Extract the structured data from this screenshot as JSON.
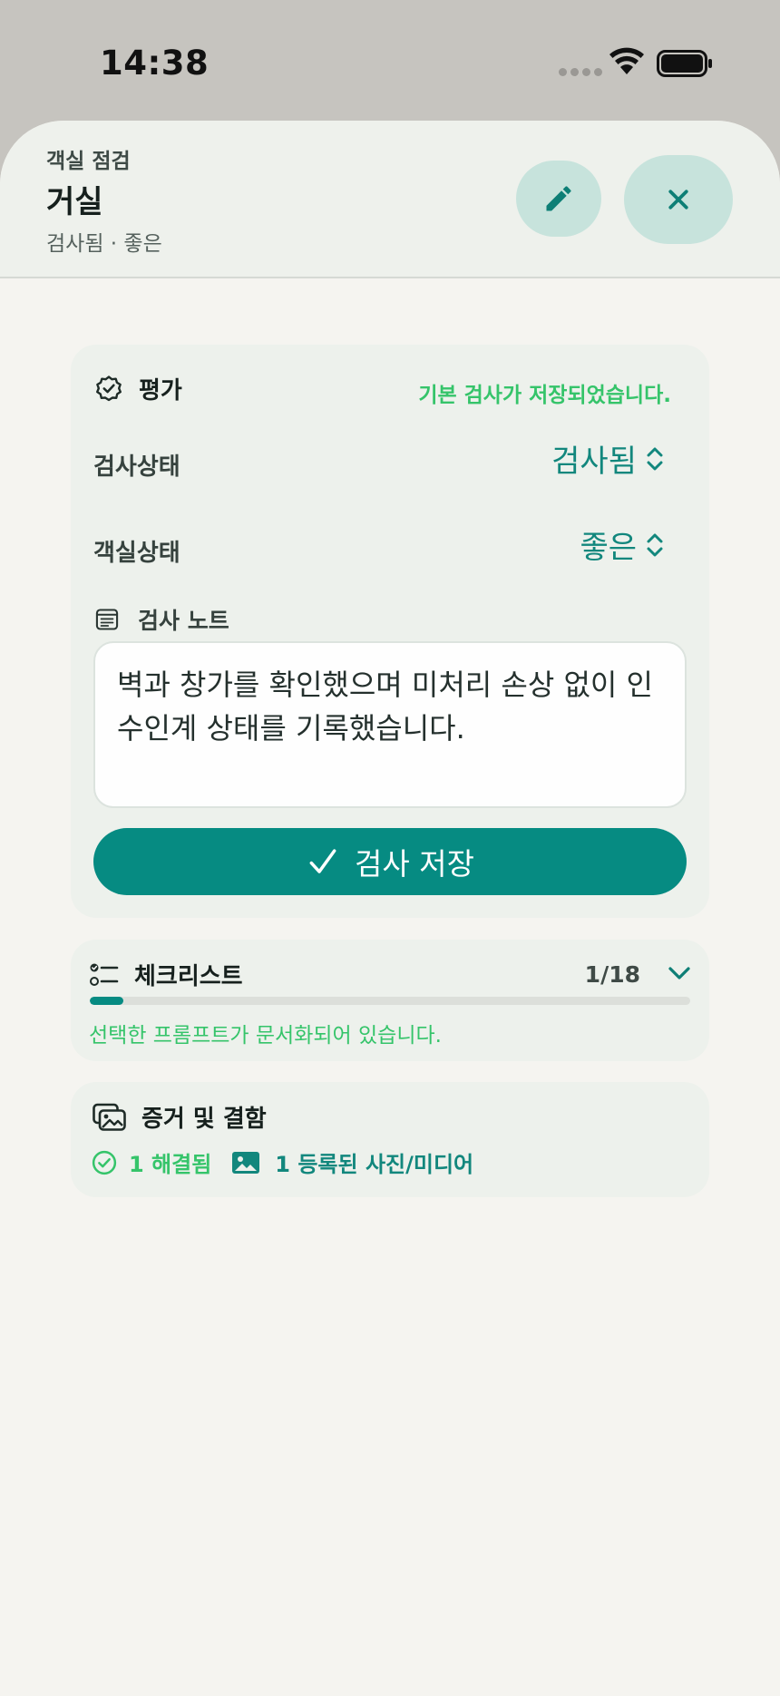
{
  "status_bar": {
    "time": "14:38"
  },
  "header": {
    "kicker": "객실 점검",
    "title": "거실",
    "subtitle": "검사됨 · 좋은"
  },
  "evaluation": {
    "title": "평가",
    "saved_message": "기본 검사가 저장되었습니다.",
    "inspection_status_label": "검사상태",
    "inspection_status_value": "검사됨",
    "room_condition_label": "객실상태",
    "room_condition_value": "좋은",
    "notes_label": "검사 노트",
    "notes_text": "벽과 창가를 확인했으며 미처리 손상 없이 인수인계 상태를 기록했습니다.",
    "save_button": "검사 저장"
  },
  "checklist": {
    "title": "체크리스트",
    "count": "1/18",
    "progress": 0.0556,
    "note": "선택한 프롬프트가 문서화되어 있습니다."
  },
  "evidence": {
    "title": "증거 및 결함",
    "resolved": "1 해결됨",
    "media": "1 등록된 사진/미디어"
  },
  "colors": {
    "accent": "#068b82",
    "success": "#35c46a",
    "sheet_bg": "#f5f4f0",
    "card_bg": "#edf1ec"
  }
}
